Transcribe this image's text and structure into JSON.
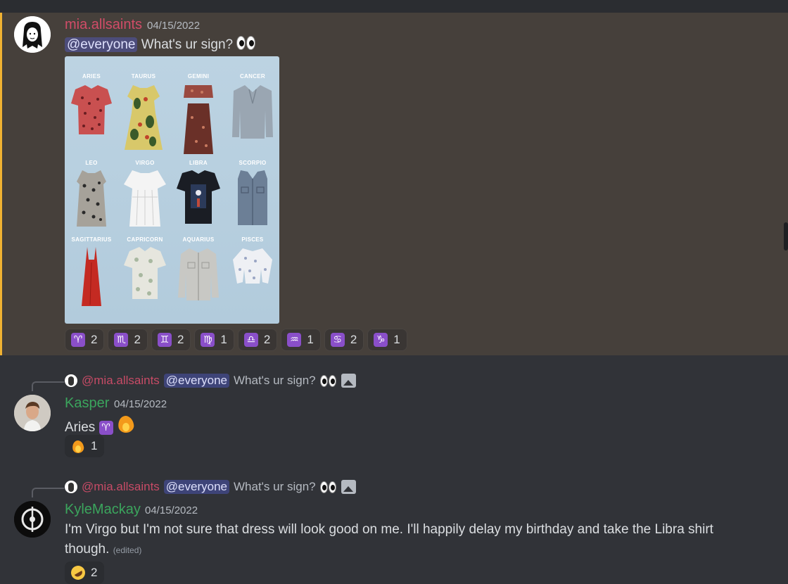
{
  "messages": [
    {
      "username": "mia.allsaints",
      "username_color": "#d14c68",
      "timestamp": "04/15/2022",
      "mention": "@everyone",
      "text": "What's ur sign?",
      "emoji": "eyes",
      "attachment": {
        "labels": [
          "ARIES",
          "TAURUS",
          "GEMINI",
          "CANCER",
          "LEO",
          "VIRGO",
          "LIBRA",
          "SCORPIO",
          "SAGITTARIUS",
          "CAPRICORN",
          "AQUARIUS",
          "PISCES"
        ]
      },
      "reactions": [
        {
          "emoji": "♈",
          "count": "2"
        },
        {
          "emoji": "♏",
          "count": "2"
        },
        {
          "emoji": "♊",
          "count": "2"
        },
        {
          "emoji": "♍",
          "count": "1"
        },
        {
          "emoji": "♎",
          "count": "2"
        },
        {
          "emoji": "♒",
          "count": "1"
        },
        {
          "emoji": "♋",
          "count": "2"
        },
        {
          "emoji": "♑",
          "count": "1"
        }
      ]
    },
    {
      "reply_to": {
        "username": "@mia.allsaints",
        "mention": "@everyone",
        "text": "What's ur sign?"
      },
      "username": "Kasper",
      "username_color": "#3ba55d",
      "timestamp": "04/15/2022",
      "text": "Aries",
      "sign": "♈",
      "reactions": [
        {
          "emoji": "fire",
          "count": "1"
        }
      ]
    },
    {
      "reply_to": {
        "username": "@mia.allsaints",
        "mention": "@everyone",
        "text": "What's ur sign?"
      },
      "username": "KyleMackay",
      "username_color": "#3ba55d",
      "timestamp": "04/15/2022",
      "text_line1": "I'm Virgo but I'm not sure that dress will look good on me. I'll happily delay my birthday and take the Libra shirt",
      "text_line2": "though.",
      "edited": "(edited)",
      "reactions": [
        {
          "emoji": "rofl",
          "count": "2"
        }
      ]
    }
  ]
}
